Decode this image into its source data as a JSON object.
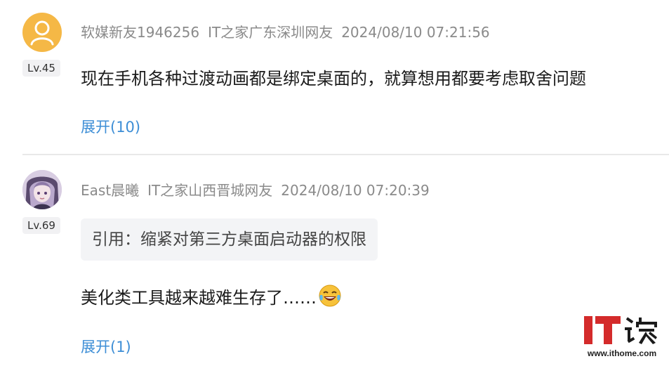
{
  "comments": [
    {
      "username": "软媒新友1946256",
      "location": "IT之家广东深圳网友",
      "timestamp": "2024/08/10 07:21:56",
      "level": "Lv.45",
      "text": "现在手机各种过渡动画都是绑定桌面的，就算想用都要考虑取舍问题",
      "expand_label": "展开(10)"
    },
    {
      "username": "East晨曦",
      "location": "IT之家山西晋城网友",
      "timestamp": "2024/08/10 07:20:39",
      "level": "Lv.69",
      "quote": "引用：缩紧对第三方桌面启动器的权限",
      "text": "美化类工具越来越难生存了……",
      "expand_label": "展开(1)"
    }
  ],
  "watermark": {
    "logo_text": "IT之家",
    "url": "www.ithome.com"
  },
  "colors": {
    "link": "#3d8ed6",
    "meta": "#8a8a8a",
    "level_bg": "#f1f1f3",
    "quote_bg": "#f3f4f6",
    "default_avatar": "#f5b846",
    "logo_red": "#d42b2b"
  },
  "icons": {
    "default_avatar": "user-silhouette-icon",
    "emoji": "laughing-crying-face-icon"
  }
}
